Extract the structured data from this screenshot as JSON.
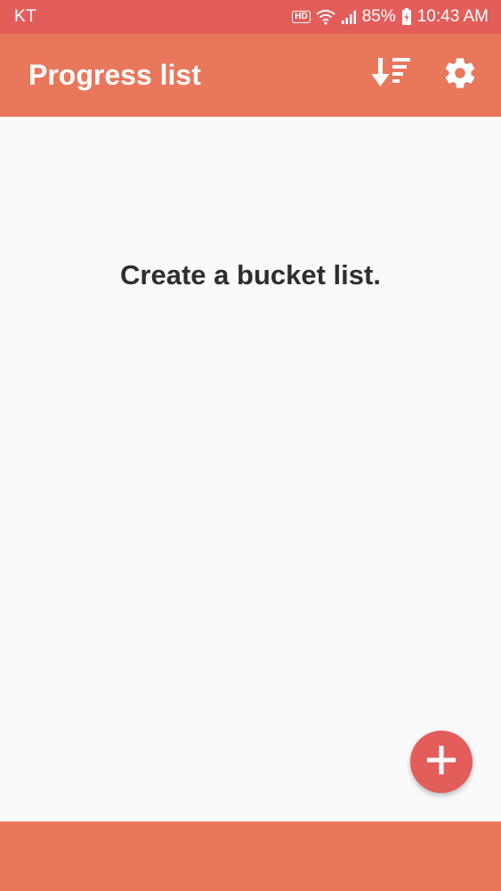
{
  "status_bar": {
    "carrier": "KT",
    "hd_badge": "HD",
    "battery": "85%",
    "time": "10:43 AM",
    "icons": [
      "hd-icon",
      "wifi-icon",
      "signal-icon",
      "battery-charging-icon"
    ]
  },
  "app_bar": {
    "title": "Progress list",
    "actions": [
      {
        "name": "sort",
        "icon": "sort-icon"
      },
      {
        "name": "settings",
        "icon": "gear-icon"
      }
    ]
  },
  "content": {
    "empty_message": "Create a bucket list."
  },
  "fab": {
    "icon": "plus-icon"
  },
  "colors": {
    "status_bar": "#e35d5b",
    "app_bar": "#e8775c",
    "fab": "#e35d5b",
    "bottom_bar": "#e8775c",
    "background": "#fafafc",
    "text": "#2e2e2e"
  }
}
